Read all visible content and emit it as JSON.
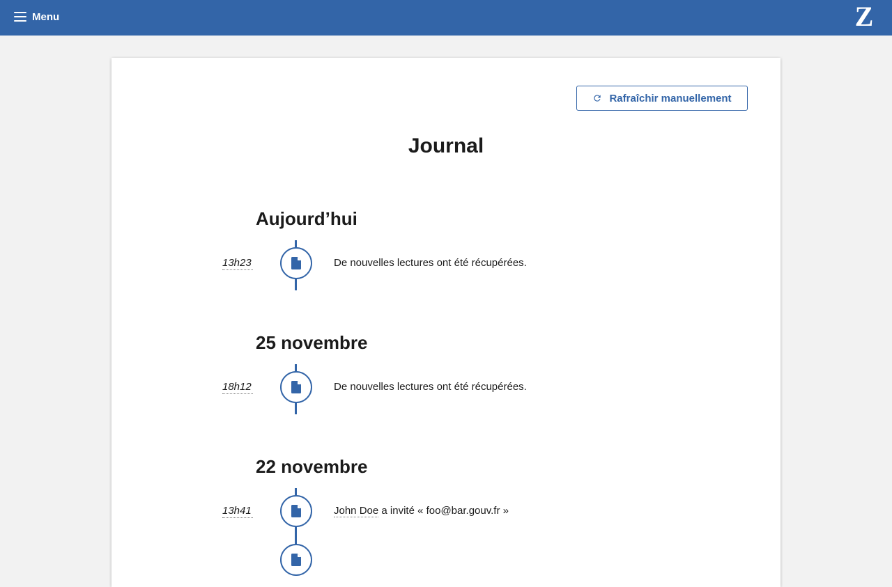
{
  "header": {
    "menu_label": "Menu",
    "logo_text": "Z"
  },
  "toolbar": {
    "refresh_label": "Rafraîchir manuellement"
  },
  "page": {
    "title": "Journal"
  },
  "journal": {
    "days": [
      {
        "label": "Aujourd’hui",
        "events": [
          {
            "time": "13h23",
            "text": "De nouvelles lectures ont été récupérées.",
            "icon": "document-icon"
          }
        ]
      },
      {
        "label": "25 novembre",
        "events": [
          {
            "time": "18h12",
            "text": "De nouvelles lectures ont été récupérées.",
            "icon": "document-icon"
          }
        ]
      },
      {
        "label": "22 novembre",
        "events": [
          {
            "time": "13h41",
            "user": "John Doe",
            "text": " a invité « foo@bar.gouv.fr »",
            "icon": "document-icon"
          },
          {
            "time": "",
            "text": "",
            "icon": "document-icon"
          }
        ]
      }
    ]
  },
  "colors": {
    "primary": "#3365a8",
    "background": "#f2f2f2",
    "card": "#ffffff",
    "text": "#1b1b1b"
  }
}
